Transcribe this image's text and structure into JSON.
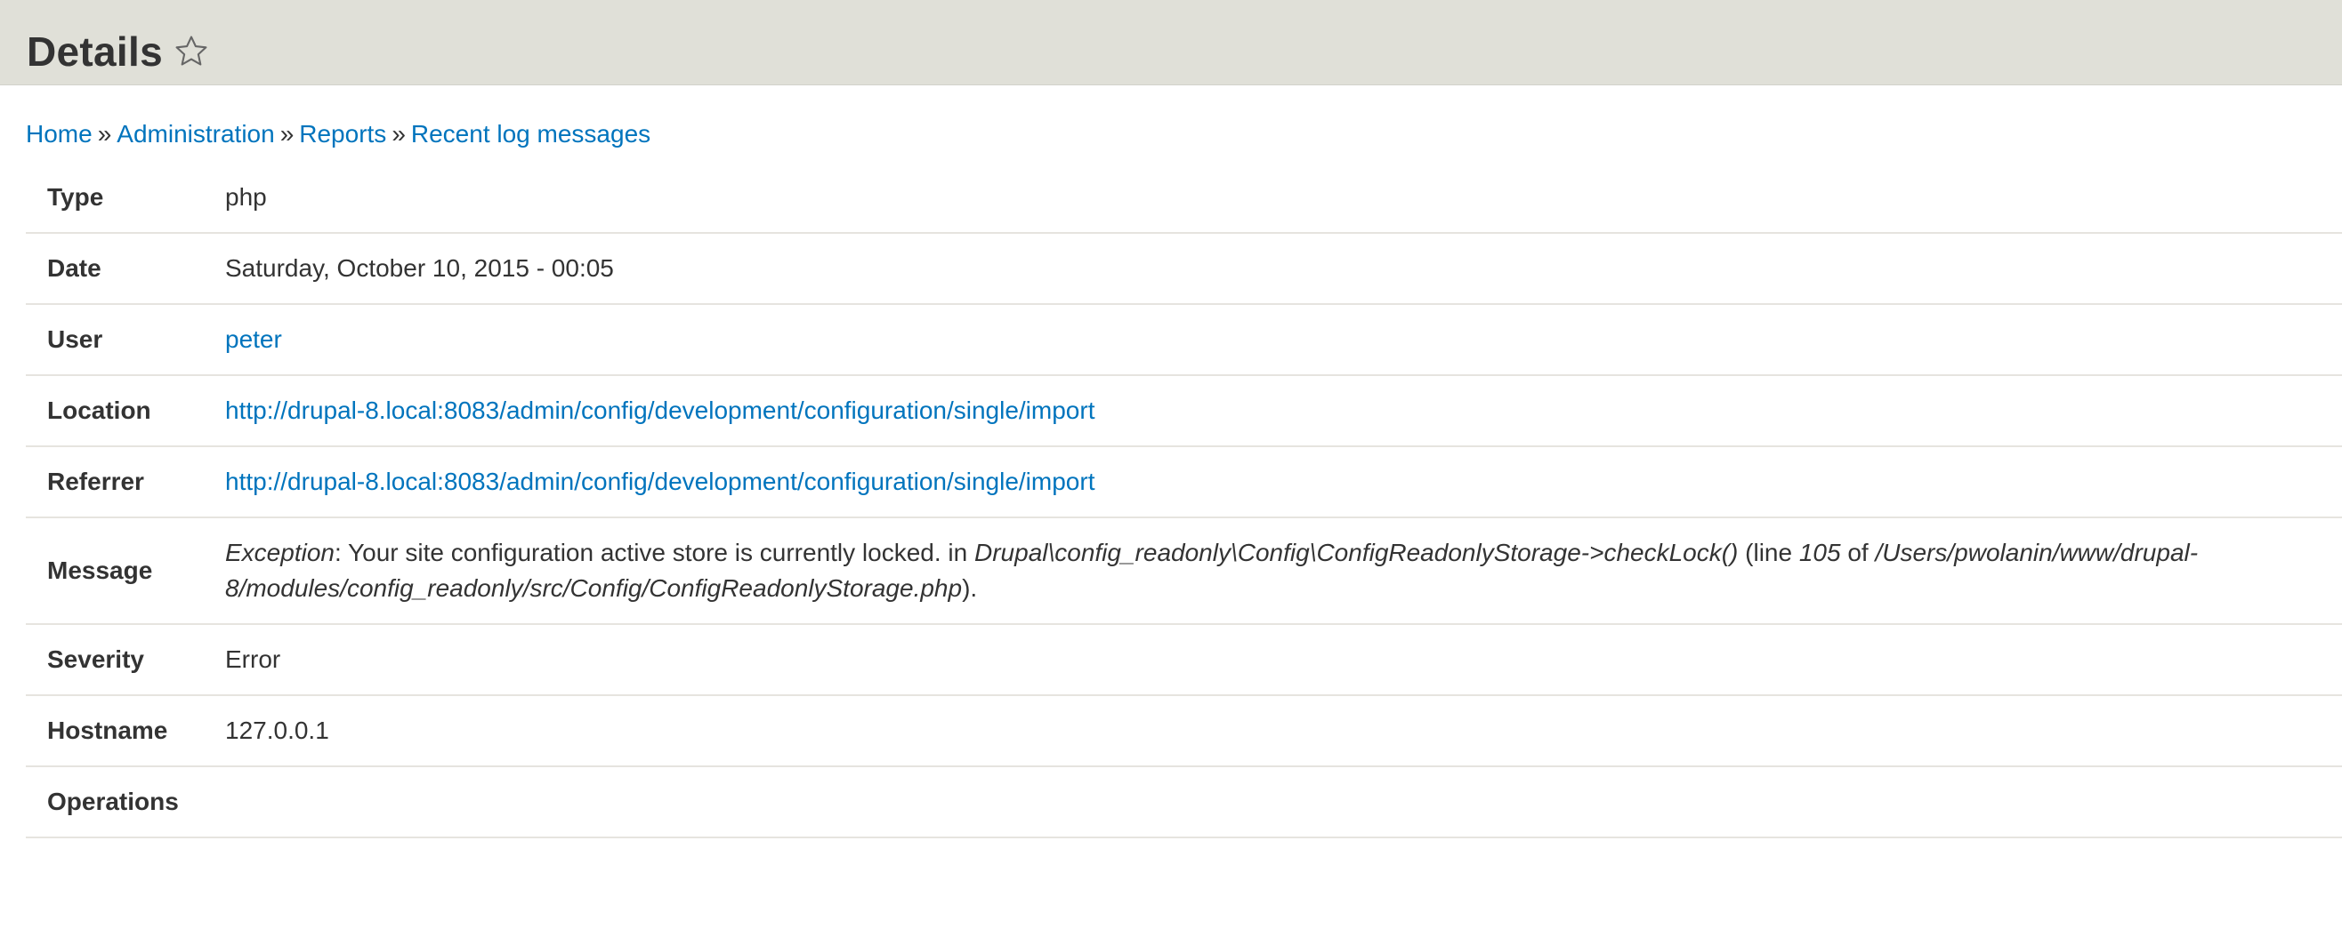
{
  "header": {
    "title": "Details",
    "star_icon": "star-outline-icon"
  },
  "breadcrumb": {
    "items": [
      "Home",
      "Administration",
      "Reports",
      "Recent log messages"
    ],
    "separator": "»"
  },
  "details": {
    "type": {
      "label": "Type",
      "value": "php"
    },
    "date": {
      "label": "Date",
      "value": "Saturday, October 10, 2015 - 00:05"
    },
    "user": {
      "label": "User",
      "value": "peter"
    },
    "location": {
      "label": "Location",
      "value": "http://drupal-8.local:8083/admin/config/development/configuration/single/import"
    },
    "referrer": {
      "label": "Referrer",
      "value": "http://drupal-8.local:8083/admin/config/development/configuration/single/import"
    },
    "message": {
      "label": "Message",
      "exception": "Exception",
      "text1": ": Your site configuration active store is currently locked. in ",
      "function": "Drupal\\config_readonly\\Config\\ConfigReadonlyStorage->checkLock()",
      "text2": " (line ",
      "line": "105",
      "text3": " of ",
      "file": "/Users/pwolanin/www/drupal-8/modules/config_readonly/src/Config/ConfigReadonlyStorage.php",
      "text4": ")."
    },
    "severity": {
      "label": "Severity",
      "value": "Error"
    },
    "hostname": {
      "label": "Hostname",
      "value": "127.0.0.1"
    },
    "operations": {
      "label": "Operations",
      "value": ""
    }
  },
  "colors": {
    "header_bg": "#e0e0d8",
    "link": "#0074bd",
    "text": "#333333",
    "row_border": "#e6e4df"
  }
}
